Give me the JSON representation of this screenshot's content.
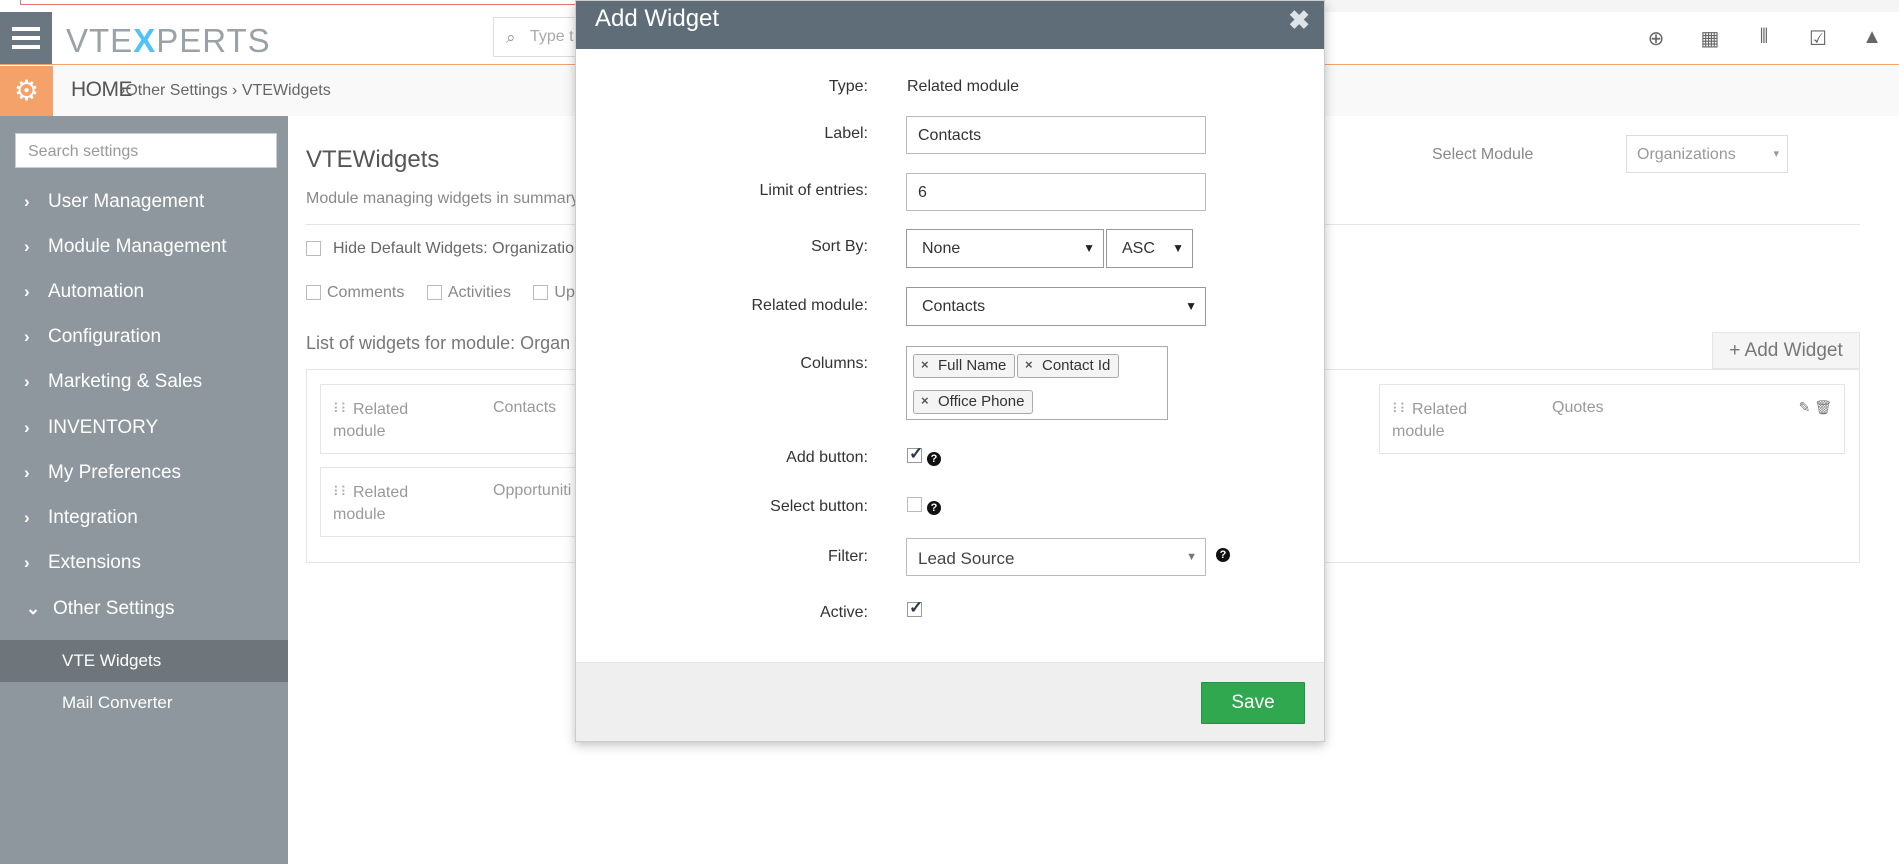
{
  "header": {
    "logo_pre": "VTE",
    "logo_x": "X",
    "logo_post": "PERTS",
    "search_placeholder": "Type t",
    "icons": [
      "plus-circle-icon",
      "calendar-icon",
      "bar-chart-icon",
      "task-check-icon",
      "user-icon"
    ]
  },
  "breadcrumb": {
    "home": "HOME",
    "rest": "›Other Settings ›  VTEWidgets"
  },
  "sidebar": {
    "search_placeholder": "Search settings",
    "items": [
      {
        "label": "User Management"
      },
      {
        "label": "Module Management"
      },
      {
        "label": "Automation"
      },
      {
        "label": "Configuration"
      },
      {
        "label": "Marketing & Sales"
      },
      {
        "label": "INVENTORY"
      },
      {
        "label": "My Preferences"
      },
      {
        "label": "Integration"
      },
      {
        "label": "Extensions"
      },
      {
        "label": "Other Settings"
      }
    ],
    "subitems": [
      {
        "label": "VTE Widgets"
      },
      {
        "label": "Mail Converter"
      }
    ]
  },
  "main": {
    "title": "VTEWidgets",
    "description": "Module managing widgets in summary",
    "hide_default": "Hide Default Widgets: Organization",
    "types": [
      "Comments",
      "Activities",
      "Upd"
    ],
    "list_title": "List of widgets for module: Organ",
    "select_module_label": "Select Module",
    "select_module_value": "Organizations",
    "add_widget": "Add Widget",
    "widgets": [
      {
        "type": "Related module",
        "name": "Contacts"
      },
      {
        "type": "Related module",
        "name": "Opportuniti"
      },
      {
        "type": "Related module",
        "name": "Quotes"
      }
    ]
  },
  "modal": {
    "title": "Add Widget",
    "close": "✖",
    "type_label": "Type:",
    "type_value": "Related module",
    "label_label": "Label:",
    "label_value": "Contacts",
    "limit_label": "Limit of entries:",
    "limit_value": "6",
    "sort_label": "Sort By:",
    "sort_value": "None",
    "order_value": "ASC",
    "related_label": "Related module:",
    "related_value": "Contacts",
    "columns_label": "Columns:",
    "columns": [
      "Full Name",
      "Contact Id",
      "Office Phone"
    ],
    "add_button_label": "Add button:",
    "add_button_checked": true,
    "select_button_label": "Select button:",
    "select_button_checked": false,
    "filter_label": "Filter:",
    "filter_value": "Lead Source",
    "active_label": "Active:",
    "active_checked": true,
    "help_glyph": "?",
    "save": "Save"
  },
  "colors": {
    "accent_orange": "#f5a16a",
    "sidebar_bg": "#8e979e",
    "modal_header": "#5f6d78",
    "save_green": "#2fa84f"
  }
}
